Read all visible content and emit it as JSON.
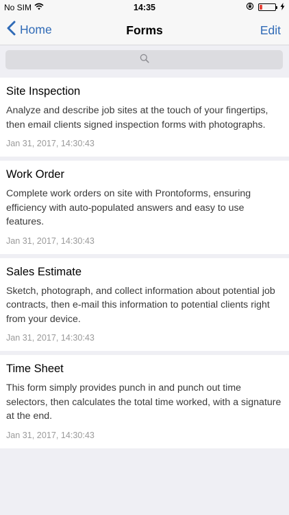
{
  "status_bar": {
    "carrier": "No SIM",
    "time": "14:35"
  },
  "nav": {
    "back_label": "Home",
    "title": "Forms",
    "edit_label": "Edit"
  },
  "search": {
    "placeholder": ""
  },
  "forms": [
    {
      "title": "Site Inspection",
      "description": "Analyze and describe job sites at the touch of your fingertips, then email clients signed inspection forms with photographs.",
      "date": "Jan 31, 2017, 14:30:43"
    },
    {
      "title": "Work Order",
      "description": "Complete work orders on site with Prontoforms, ensuring efficiency with auto-populated answers and easy to use features.",
      "date": "Jan 31, 2017, 14:30:43"
    },
    {
      "title": "Sales Estimate",
      "description": "Sketch, photograph, and collect information about potential job contracts, then e-mail this information to potential clients right from your device.",
      "date": "Jan 31, 2017, 14:30:43"
    },
    {
      "title": "Time Sheet",
      "description": "This form simply provides punch in and punch out time selectors, then calculates the total time worked, with a signature at the end.",
      "date": "Jan 31, 2017, 14:30:43"
    }
  ],
  "colors": {
    "accent": "#2f6ab6",
    "background": "#efeff4",
    "battery_low": "#e8443a"
  }
}
